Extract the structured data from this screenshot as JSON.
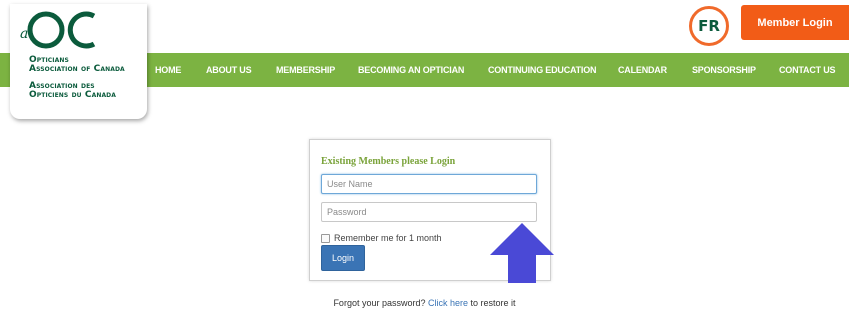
{
  "logo": {
    "mark_letters": "aOC",
    "name_en_line1": "Opticians",
    "name_en_line2": "Association of Canada",
    "name_fr_line1": "Association des",
    "name_fr_line2": "Opticiens du Canada"
  },
  "header": {
    "language_toggle": "FR",
    "member_login": "Member Login"
  },
  "nav": {
    "items": [
      {
        "label": "HOME"
      },
      {
        "label": "ABOUT US"
      },
      {
        "label": "MEMBERSHIP"
      },
      {
        "label": "BECOMING AN OPTICIAN"
      },
      {
        "label": "CONTINUING EDUCATION"
      },
      {
        "label": "CALENDAR"
      },
      {
        "label": "SPONSORSHIP"
      },
      {
        "label": "CONTACT US"
      }
    ]
  },
  "login": {
    "title": "Existing Members please Login",
    "username_placeholder": "User Name",
    "username_value": "",
    "password_placeholder": "Password",
    "password_value": "",
    "remember_label": "Remember me for 1 month",
    "remember_checked": false,
    "submit_label": "Login"
  },
  "footer": {
    "forgot_prefix": "Forgot your password?",
    "forgot_link": "Click here",
    "forgot_suffix": "to restore it"
  },
  "colors": {
    "nav_bg": "#7cb342",
    "brand_green": "#0b5b3c",
    "accent_orange": "#f25c17",
    "button_blue": "#3a74b5",
    "arrow_blue": "#4a49d6"
  },
  "icons": {
    "annotation": "up-arrow-icon"
  }
}
